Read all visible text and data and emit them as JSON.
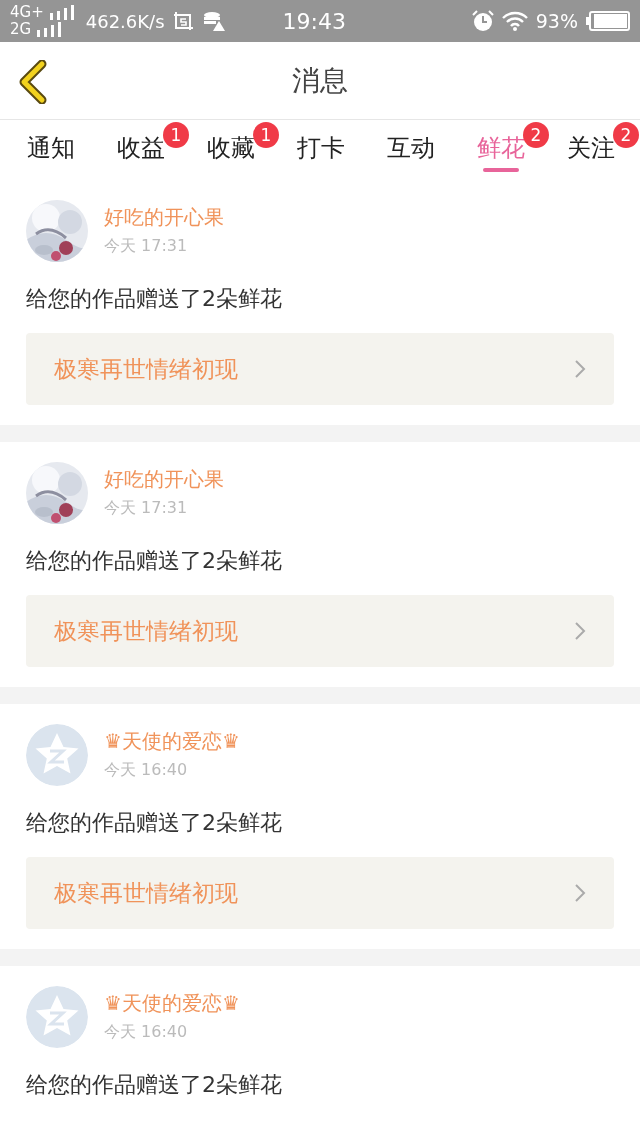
{
  "status_bar": {
    "network_1": "4G+",
    "network_2": "2G",
    "speed": "462.6K/s",
    "time": "19:43",
    "battery": "93%"
  },
  "header": {
    "title": "消息"
  },
  "tabs": [
    {
      "label": "通知",
      "selected": false
    },
    {
      "label": "收益",
      "selected": false,
      "badge": "1"
    },
    {
      "label": "收藏",
      "selected": false,
      "badge": "1"
    },
    {
      "label": "打卡",
      "selected": false
    },
    {
      "label": "互动",
      "selected": false
    },
    {
      "label": "鲜花",
      "selected": true,
      "badge": "2"
    },
    {
      "label": "关注",
      "selected": false,
      "badge": "2"
    }
  ],
  "messages": [
    {
      "name": "好吃的开心果",
      "time": "今天 17:31",
      "text": "给您的作品赠送了2朵鲜花",
      "link": "极寒再世情绪初现"
    },
    {
      "name": "好吃的开心果",
      "time": "今天 17:31",
      "text": "给您的作品赠送了2朵鲜花",
      "link": "极寒再世情绪初现"
    },
    {
      "avatar": {
        "kind": "default"
      },
      "name": "♛天使的爱恋♛",
      "time": "今天 16:40",
      "text": "给您的作品赠送了2朵鲜花",
      "link": "极寒再世情绪初现"
    },
    {
      "avatar": {
        "kind": "default"
      },
      "name": "♛天使的爱恋♛",
      "time": "今天 16:40",
      "text": "给您的作品赠送了2朵鲜花"
    }
  ]
}
